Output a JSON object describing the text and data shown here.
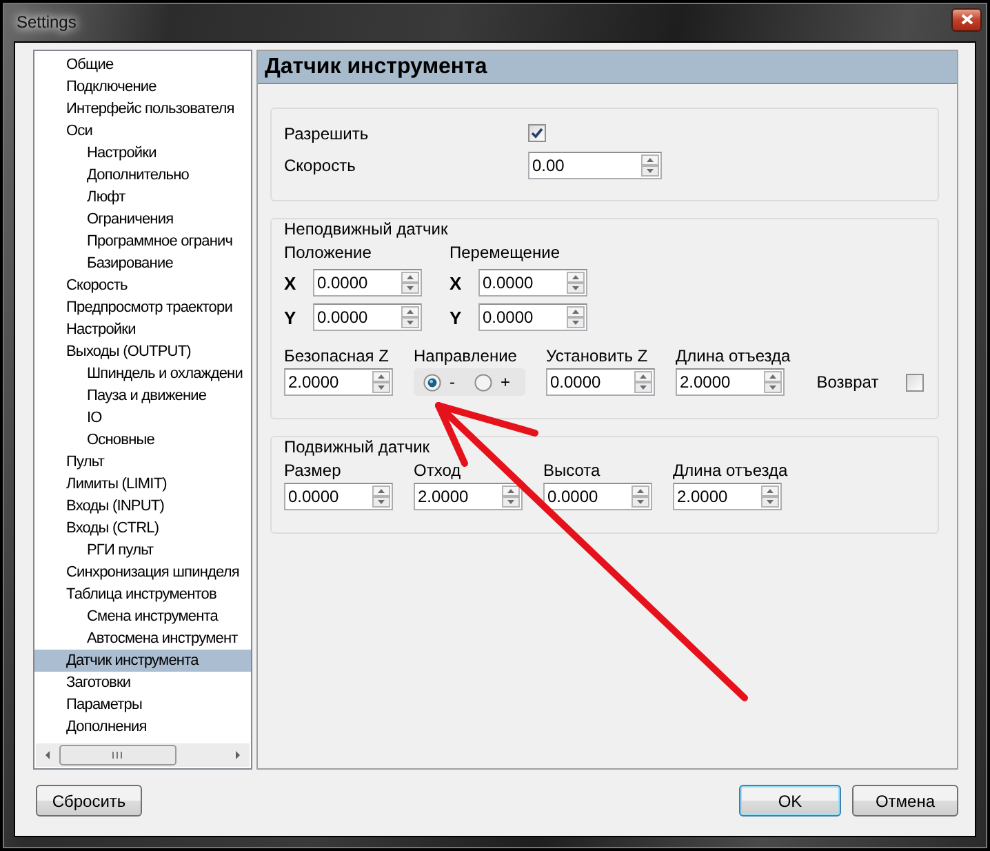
{
  "window": {
    "title": "Settings"
  },
  "sidebar": {
    "items": [
      {
        "label": "Общие",
        "selected": false
      },
      {
        "label": "Подключение",
        "selected": false
      },
      {
        "label": "Интерфейс пользователя",
        "selected": false
      },
      {
        "label": "Оси",
        "selected": false,
        "children": [
          {
            "label": "Настройки",
            "selected": false
          },
          {
            "label": "Дополнительно",
            "selected": false
          },
          {
            "label": "Люфт",
            "selected": false
          },
          {
            "label": "Ограничения",
            "selected": false
          },
          {
            "label": "Программное огранич",
            "selected": false
          },
          {
            "label": "Базирование",
            "selected": false
          }
        ]
      },
      {
        "label": "Скорость",
        "selected": false
      },
      {
        "label": "Предпросмотр траектори",
        "selected": false
      },
      {
        "label": "Настройки",
        "selected": false
      },
      {
        "label": "Выходы (OUTPUT)",
        "selected": false,
        "children": [
          {
            "label": "Шпиндель и охлаждени",
            "selected": false
          },
          {
            "label": "Пауза и движение",
            "selected": false
          },
          {
            "label": "IO",
            "selected": false
          },
          {
            "label": "Основные",
            "selected": false
          }
        ]
      },
      {
        "label": "Пульт",
        "selected": false
      },
      {
        "label": "Лимиты (LIMIT)",
        "selected": false
      },
      {
        "label": "Входы (INPUT)",
        "selected": false
      },
      {
        "label": "Входы (CTRL)",
        "selected": false,
        "children": [
          {
            "label": "РГИ пульт",
            "selected": false
          }
        ]
      },
      {
        "label": "Синхронизация шпинделя",
        "selected": false
      },
      {
        "label": "Таблица инструментов",
        "selected": false,
        "children": [
          {
            "label": "Смена инструмента",
            "selected": false
          },
          {
            "label": "Автосмена инструмент",
            "selected": false
          }
        ]
      },
      {
        "label": "Датчик инструмента",
        "selected": true
      },
      {
        "label": "Заготовки",
        "selected": false
      },
      {
        "label": "Параметры",
        "selected": false
      },
      {
        "label": "Дополнения",
        "selected": false
      }
    ]
  },
  "panel": {
    "title": "Датчик инструмента",
    "general": {
      "enable": {
        "label": "Разрешить",
        "checked": true
      },
      "speed": {
        "label": "Скорость",
        "value": "0.00"
      }
    },
    "fixed_sensor": {
      "title": "Неподвижный датчик",
      "coordinates": [
        {
          "label": "Положение",
          "axes": [
            {
              "axis": "X",
              "value": "0.0000"
            },
            {
              "axis": "Y",
              "value": "0.0000"
            }
          ]
        },
        {
          "label": "Перемещение",
          "axes": [
            {
              "axis": "X",
              "value": "0.0000"
            },
            {
              "axis": "Y",
              "value": "0.0000"
            }
          ]
        }
      ],
      "safe_z": {
        "label": "Безопасная Z",
        "value": "2.0000"
      },
      "direction": {
        "label": "Направление",
        "options": [
          {
            "label": "-",
            "selected": true
          },
          {
            "label": "+",
            "selected": false
          }
        ]
      },
      "set_z": {
        "label": "Установить Z",
        "value": "0.0000"
      },
      "retract_length": {
        "label": "Длина отъезда",
        "value": "2.0000"
      },
      "return": {
        "label": "Возврат",
        "checked": false
      }
    },
    "mobile_sensor": {
      "title": "Подвижный датчик",
      "fields": [
        {
          "label": "Размер",
          "value": "0.0000"
        },
        {
          "label": "Отход",
          "value": "2.0000"
        },
        {
          "label": "Высота",
          "value": "0.0000"
        },
        {
          "label": "Длина отъезда",
          "value": "2.0000"
        }
      ]
    }
  },
  "buttons": {
    "reset": {
      "label": "Сбросить",
      "default": false
    },
    "ok": {
      "label": "OK",
      "default": true
    },
    "cancel": {
      "label": "Отмена",
      "default": false
    }
  }
}
